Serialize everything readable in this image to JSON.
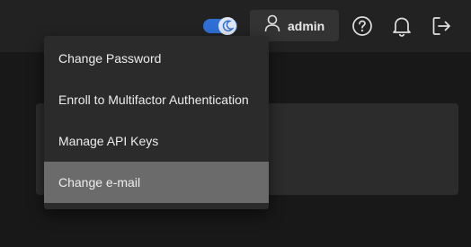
{
  "header": {
    "user_label": "admin",
    "icons": [
      "theme-toggle-moon-icon",
      "user-icon",
      "help-icon",
      "bell-icon",
      "logout-icon"
    ]
  },
  "user_menu": {
    "items": [
      {
        "label": "Change Password"
      },
      {
        "label": "Enroll to Multifactor Authentication"
      },
      {
        "label": "Manage API Keys"
      },
      {
        "label": "Change e-mail",
        "active": true
      }
    ]
  },
  "colors": {
    "topbar_bg": "#222222",
    "page_bg": "#181818",
    "menu_bg": "#2b2b2b",
    "menu_active_bg": "#6b6b6b",
    "toggle_accent": "#2f6fd6"
  }
}
